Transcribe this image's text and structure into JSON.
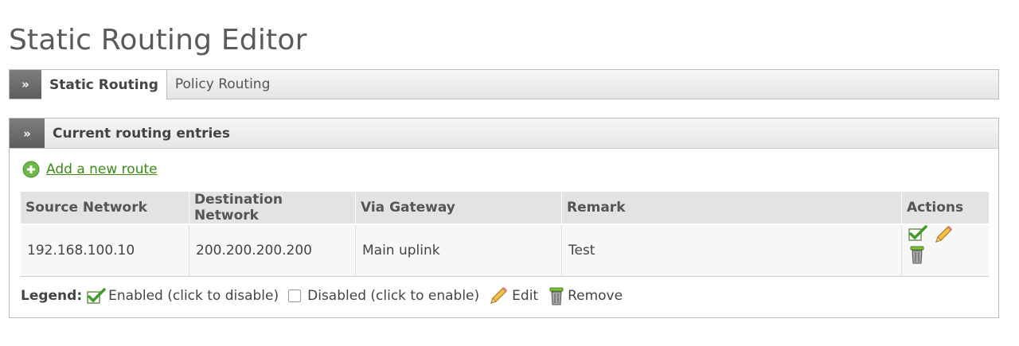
{
  "page": {
    "title": "Static Routing Editor"
  },
  "tabs": {
    "chevron": "»",
    "items": [
      {
        "label": "Static Routing",
        "active": true
      },
      {
        "label": "Policy Routing",
        "active": false
      }
    ]
  },
  "panel": {
    "chevron": "»",
    "title": "Current routing entries",
    "add_link": "Add a new route",
    "columns": [
      "Source Network",
      "Destination Network",
      "Via Gateway",
      "Remark",
      "Actions"
    ],
    "rows": [
      {
        "source": "192.168.100.10",
        "destination": "200.200.200.200",
        "gateway": "Main uplink",
        "remark": "Test",
        "actions": [
          "enabled-check-icon",
          "edit-pencil-icon",
          "remove-trash-icon"
        ]
      }
    ]
  },
  "legend": {
    "label": "Legend:",
    "enabled": "Enabled (click to disable)",
    "disabled": "Disabled (click to enable)",
    "edit": "Edit",
    "remove": "Remove"
  },
  "colors": {
    "link": "#3e8a1a",
    "gateway": "#9b1b1b",
    "chevron_bg": "#6e6e6e"
  }
}
